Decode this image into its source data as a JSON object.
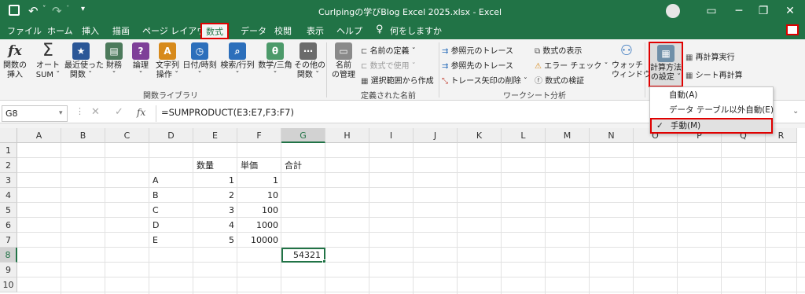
{
  "titlebar": {
    "title": "Curlpingの学びBlog  Excel  2025.xlsx  -  Excel"
  },
  "tabs": [
    "ファイル",
    "ホーム",
    "挿入",
    "描画",
    "ページ レイアウト",
    "数式",
    "データ",
    "校閲",
    "表示",
    "ヘルプ",
    "何をしますか"
  ],
  "ribbon": {
    "insert_function": "関数の\n挿入",
    "autosum": "オート\nSUM ˇ",
    "recent": "最近使った\n関数 ˇ",
    "financial": "財務\nˇ",
    "logical": "論理\nˇ",
    "text": "文字列\n操作 ˇ",
    "datetime": "日付/時刻\nˇ",
    "lookup": "検索/行列\nˇ",
    "math": "数学/三角\nˇ",
    "more": "その他の\n関数 ˇ",
    "group_library": "関数ライブラリ",
    "name_manager": "名前\nの管理",
    "define_name": "名前の定義  ˇ",
    "use_in_formula": "数式で使用  ˇ",
    "create_from_selection": "選択範囲から作成",
    "group_names": "定義された名前",
    "trace_precedents": "参照元のトレース",
    "trace_dependents": "参照先のトレース",
    "remove_arrows": "トレース矢印の削除  ˇ",
    "show_formulas": "数式の表示",
    "error_checking": "エラー チェック  ˇ",
    "evaluate_formula": "数式の検証",
    "watch_window": "ウォッチ\nウィンドウ",
    "group_audit": "ワークシート分析",
    "calc_options": "計算方法\nの設定 ˇ",
    "calc_now": "再計算実行",
    "calc_sheet": "シート再計算"
  },
  "formula_bar": {
    "name_box": "G8",
    "fx": "fx",
    "formula": "=SUMPRODUCT(E3:E7,F3:F7)"
  },
  "columns": [
    "A",
    "B",
    "C",
    "D",
    "E",
    "F",
    "G",
    "H",
    "I",
    "J",
    "K",
    "L",
    "M",
    "N",
    "O",
    "P",
    "Q",
    "R"
  ],
  "rows": [
    "1",
    "2",
    "3",
    "4",
    "5",
    "6",
    "7",
    "8",
    "9",
    "10"
  ],
  "headers": {
    "qty": "数量",
    "price": "単価",
    "total": "合計"
  },
  "data_rows": [
    {
      "item": "A",
      "qty": "1",
      "price": "1"
    },
    {
      "item": "B",
      "qty": "2",
      "price": "10"
    },
    {
      "item": "C",
      "qty": "3",
      "price": "100"
    },
    {
      "item": "D",
      "qty": "4",
      "price": "1000"
    },
    {
      "item": "E",
      "qty": "5",
      "price": "10000"
    }
  ],
  "result": "54321",
  "calc_menu": {
    "auto": "自動(A)",
    "auto_except_tables": "データ テーブル以外自動(E)",
    "manual": "手動(M)",
    "check": "✓"
  },
  "colors": {
    "excel_green": "#217346",
    "highlight_red": "#e00000"
  }
}
